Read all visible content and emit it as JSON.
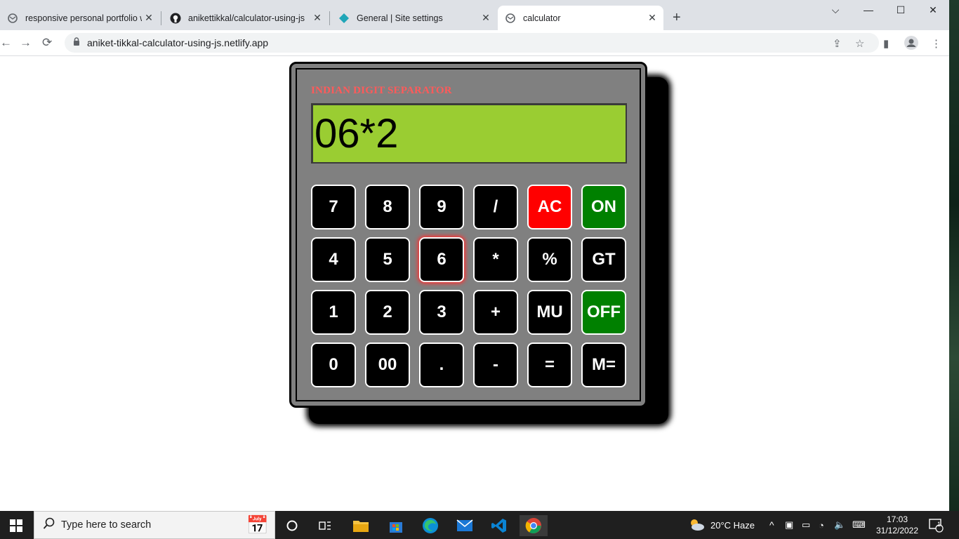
{
  "browser": {
    "tabs": [
      {
        "title": "responsive personal portfolio we",
        "icon": "globe-icon"
      },
      {
        "title": "anikettikkal/calculator-using-js",
        "icon": "github-icon"
      },
      {
        "title": "General | Site settings",
        "icon": "netlify-icon"
      },
      {
        "title": "calculator",
        "icon": "globe-icon"
      }
    ],
    "url": "aniket-tikkal-calculator-using-js.netlify.app"
  },
  "calculator": {
    "title": "INDIAN DIGIT SEPARATOR",
    "display": "06*2",
    "buttons": [
      [
        "7",
        "8",
        "9",
        "/",
        "AC",
        "ON"
      ],
      [
        "4",
        "5",
        "6",
        "*",
        "%",
        "GT"
      ],
      [
        "1",
        "2",
        "3",
        "+",
        "MU",
        "OFF"
      ],
      [
        "0",
        "00",
        ".",
        "-",
        "=",
        "M="
      ]
    ],
    "colors": {
      "body": "#808080",
      "display": "#9acd32",
      "title": "#ff5a5a",
      "ac": "#ff0000",
      "on_off": "#008000"
    }
  },
  "taskbar": {
    "search_placeholder": "Type here to search",
    "weather": "20°C  Haze",
    "time": "17:03",
    "date": "31/12/2022",
    "notification_count": "1"
  }
}
